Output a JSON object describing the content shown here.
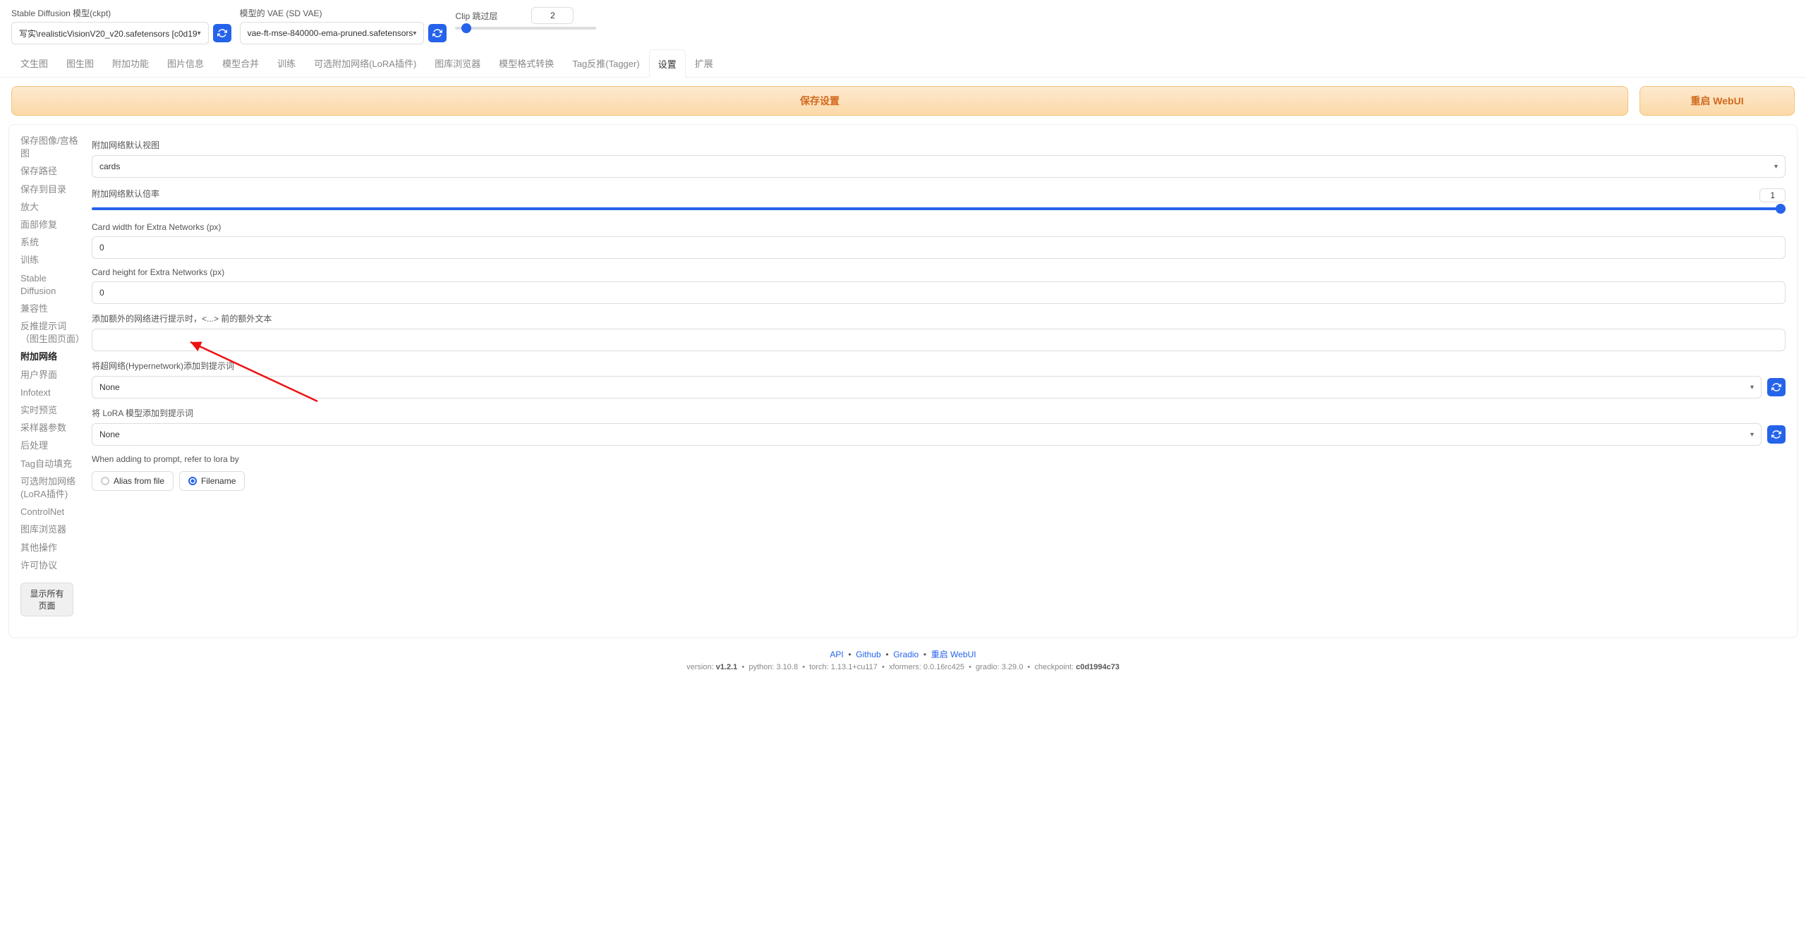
{
  "header": {
    "model_label": "Stable Diffusion 模型(ckpt)",
    "model_value": "写实\\realisticVisionV20_v20.safetensors [c0d19",
    "vae_label": "模型的 VAE (SD VAE)",
    "vae_value": "vae-ft-mse-840000-ema-pruned.safetensors",
    "clip_label": "Clip 跳过层",
    "clip_value": "2"
  },
  "tabs": [
    "文生图",
    "图生图",
    "附加功能",
    "图片信息",
    "模型合并",
    "训练",
    "可选附加网络(LoRA插件)",
    "图库浏览器",
    "模型格式转换",
    "Tag反推(Tagger)",
    "设置",
    "扩展"
  ],
  "active_tab": 10,
  "actions": {
    "save": "保存设置",
    "restart": "重启 WebUI"
  },
  "sidebar": [
    "保存图像/宫格图",
    "保存路径",
    "保存到目录",
    "放大",
    "面部修复",
    "系统",
    "训练",
    "Stable Diffusion",
    "兼容性",
    "反推提示词（图生图页面）",
    "附加网络",
    "用户界面",
    "Infotext",
    "实时预览",
    "采样器参数",
    "后处理",
    "Tag自动填充",
    "可选附加网络(LoRA插件)",
    "ControlNet",
    "图库浏览器",
    "其他操作",
    "许可协议"
  ],
  "sidebar_active": 10,
  "show_all": "显示所有页面",
  "fields": {
    "default_view_label": "附加网络默认视图",
    "default_view_value": "cards",
    "multiplier_label": "附加网络默认倍率",
    "multiplier_value": "1",
    "card_width_label": "Card width for Extra Networks (px)",
    "card_width_value": "0",
    "card_height_label": "Card height for Extra Networks (px)",
    "card_height_value": "0",
    "extra_text_label": "添加额外的网络进行提示时，<...> 前的额外文本",
    "extra_text_value": "",
    "hypernet_label": "将超网络(Hypernetwork)添加到提示词",
    "hypernet_value": "None",
    "lora_label": "将 LoRA 模型添加到提示词",
    "lora_value": "None",
    "refer_label": "When adding to prompt, refer to lora by",
    "radio_alias": "Alias from file",
    "radio_filename": "Filename"
  },
  "footer": {
    "links": [
      "API",
      "Github",
      "Gradio",
      "重启 WebUI"
    ],
    "version": "v1.2.1",
    "python": "3.10.8",
    "torch": "1.13.1+cu117",
    "xformers": "0.0.16rc425",
    "gradio": "3.29.0",
    "checkpoint": "c0d1994c73"
  }
}
